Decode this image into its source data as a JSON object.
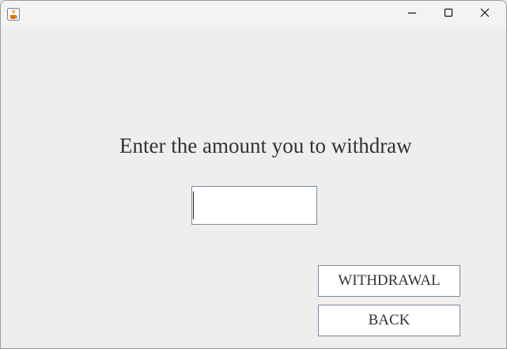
{
  "window": {
    "icon": "java-cup-icon",
    "controls": {
      "minimize_icon": "minimize-icon",
      "maximize_icon": "maximize-icon",
      "close_icon": "close-icon"
    }
  },
  "main": {
    "prompt": "Enter the amount you to withdraw",
    "amount_input": {
      "value": "",
      "placeholder": ""
    },
    "withdrawal_label": "WITHDRAWAL",
    "back_label": "BACK"
  },
  "colors": {
    "background": "#eeeeee",
    "titlebar": "#f5f3f1",
    "border": "#7a8a99",
    "text": "#333333"
  }
}
